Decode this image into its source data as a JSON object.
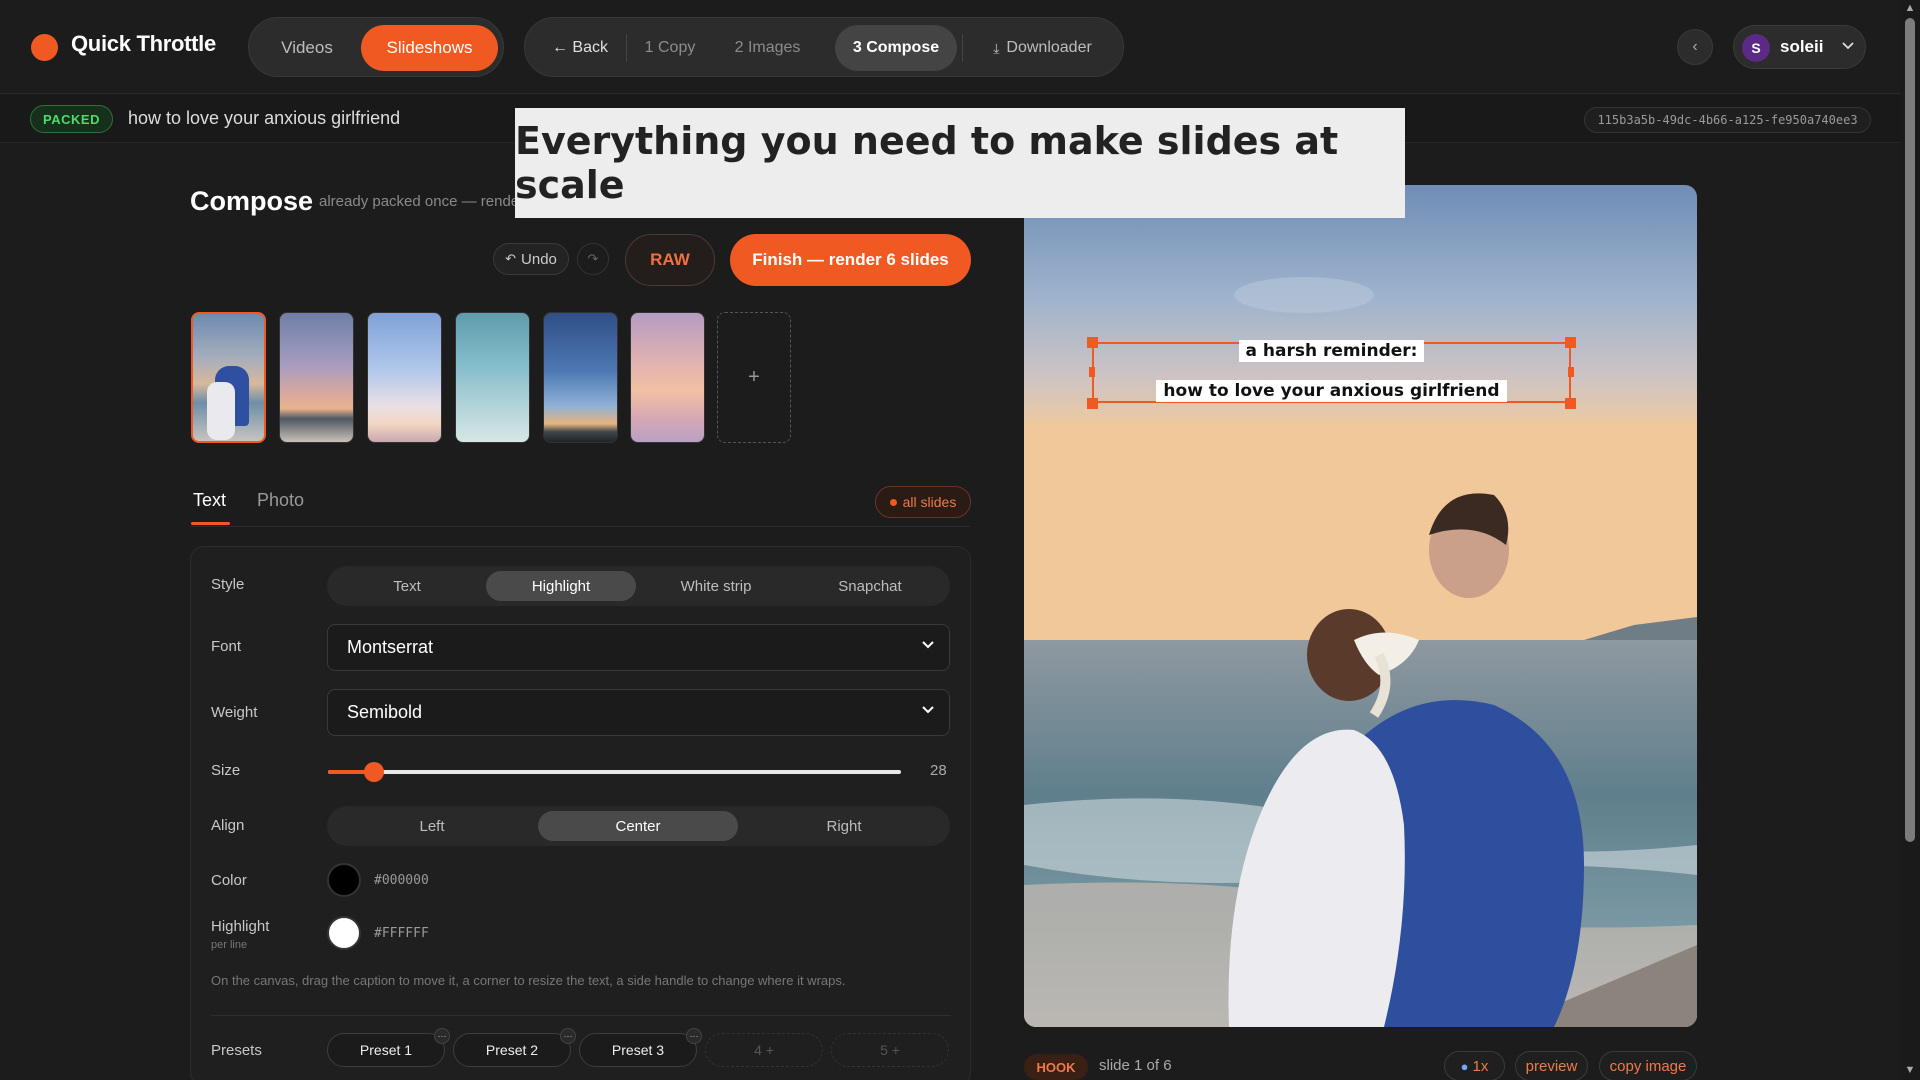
{
  "app": {
    "name": "Quick Throttle"
  },
  "mode_tabs": [
    {
      "label": "Videos"
    },
    {
      "label": "Slideshows"
    }
  ],
  "steps": {
    "back": "← Back",
    "copy": "1 Copy",
    "images": "2 Images",
    "compose": "3 Compose",
    "downloader": "Downloader"
  },
  "user": {
    "initial": "S",
    "name": "soleii"
  },
  "project": {
    "status": "PACKED",
    "title": "how to love your anxious girlfriend",
    "id": "115b3a5b-49dc-4b66-a125-fe950a740ee3"
  },
  "banner": {
    "text": "Everything you need to make slides at scale"
  },
  "compose": {
    "title": "Compose",
    "subtitle": "already packed once — rende",
    "undo": "Undo",
    "raw": "RAW",
    "finish": "Finish — render 6 slides",
    "add": "+"
  },
  "thumbnails_count": 6,
  "tabs": {
    "text": "Text",
    "photo": "Photo",
    "scope": "all slides"
  },
  "controls": {
    "style_label": "Style",
    "style_options": [
      "Text",
      "Highlight",
      "White strip",
      "Snapchat"
    ],
    "style_selected": "Highlight",
    "font_label": "Font",
    "font_value": "Montserrat",
    "weight_label": "Weight",
    "weight_value": "Semibold",
    "size_label": "Size",
    "size_value": 28,
    "size_fraction": 0.08,
    "align_label": "Align",
    "align_options": [
      "Left",
      "Center",
      "Right"
    ],
    "align_selected": "Center",
    "color_label": "Color",
    "color_hex": "#000000",
    "highlight_label": "Highlight",
    "highlight_sub": "per line",
    "highlight_hex": "#FFFFFF",
    "help": "On the canvas, drag the caption to move it, a corner to resize the text, a side handle to change where it wraps.",
    "presets_label": "Presets",
    "presets": [
      "Preset 1",
      "Preset 2",
      "Preset 3",
      "4 +",
      "5 +"
    ]
  },
  "preview": {
    "caption_lines": [
      "a harsh reminder:",
      "how to love your anxious girlfriend"
    ],
    "badge": "HOOK",
    "slide_info": "slide 1 of 6",
    "zoom": "1x",
    "preview_btn": "preview",
    "copy_btn": "copy image"
  },
  "colors": {
    "accent": "#f05a22",
    "packed_green": "#4ddb6a"
  }
}
